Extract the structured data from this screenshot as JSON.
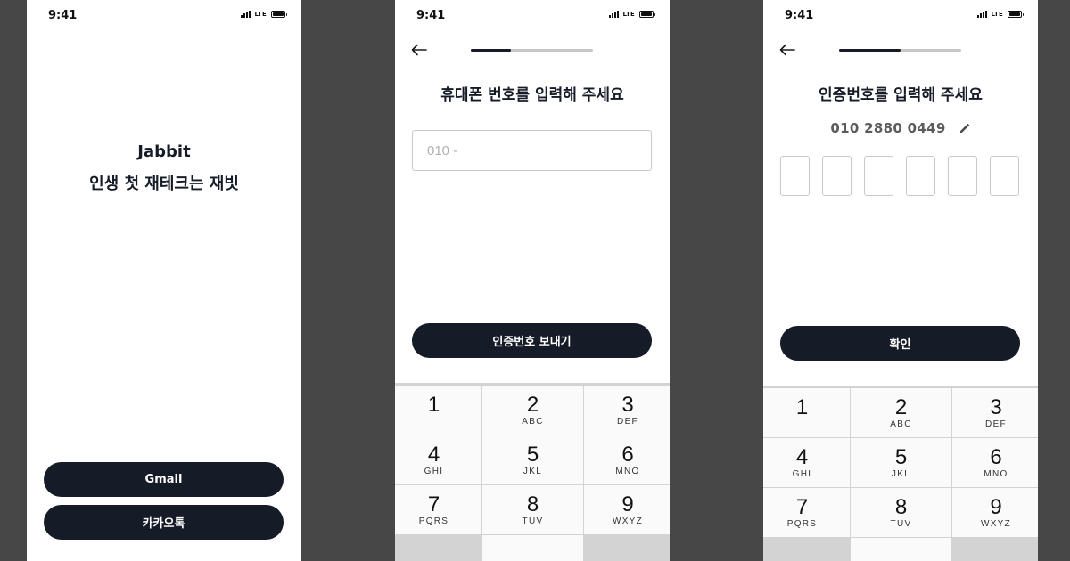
{
  "status_bar": {
    "time": "9:41",
    "network": "LTE"
  },
  "welcome_screen": {
    "brand": "Jabbit",
    "tagline": "인생 첫 재테크는 재빗",
    "gmail_button": "Gmail",
    "kakao_button": "카카오톡"
  },
  "phone_screen": {
    "progress": 0.33,
    "title": "휴대폰 번호를 입력해 주세요",
    "input_placeholder": "010 -",
    "send_button": "인증번호 보내기"
  },
  "verify_screen": {
    "progress": 0.5,
    "title": "인증번호를 입력해 주세요",
    "phone_number": "010 2880 0449",
    "code_length": 6,
    "confirm_button": "확인"
  },
  "keypad": {
    "keys": [
      {
        "num": "1",
        "letters": ""
      },
      {
        "num": "2",
        "letters": "ABC"
      },
      {
        "num": "3",
        "letters": "DEF"
      },
      {
        "num": "4",
        "letters": "GHI"
      },
      {
        "num": "5",
        "letters": "JKL"
      },
      {
        "num": "6",
        "letters": "MNO"
      },
      {
        "num": "7",
        "letters": "PQRS"
      },
      {
        "num": "8",
        "letters": "TUV"
      },
      {
        "num": "9",
        "letters": "WXYZ"
      }
    ]
  },
  "icons": {
    "back": "back-arrow-icon",
    "edit": "pencil-icon"
  },
  "colors": {
    "background": "#474747",
    "primary": "#161c27",
    "keypad": "#d3d3d3"
  }
}
